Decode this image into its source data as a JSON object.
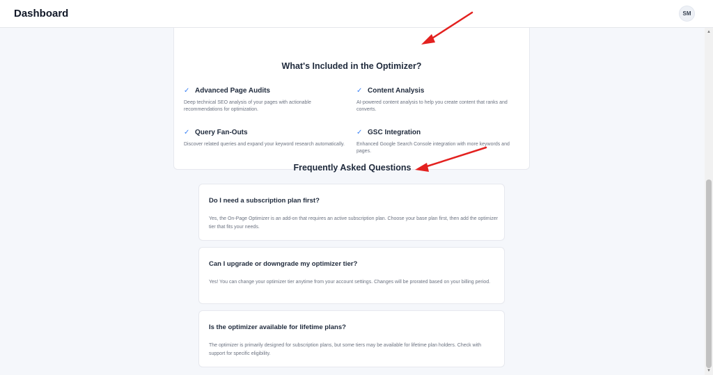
{
  "header": {
    "title": "Dashboard",
    "avatar_initials": "SM"
  },
  "included": {
    "title": "What's Included in the Optimizer?",
    "features": [
      {
        "name": "Advanced Page Audits",
        "description": "Deep technical SEO analysis of your pages with actionable recommendations for optimization."
      },
      {
        "name": "Content Analysis",
        "description": "AI-powered content analysis to help you create content that ranks and converts."
      },
      {
        "name": "Query Fan-Outs",
        "description": "Discover related queries and expand your keyword research automatically."
      },
      {
        "name": "GSC Integration",
        "description": "Enhanced Google Search Console integration with more keywords and pages."
      }
    ]
  },
  "faq": {
    "title": "Frequently Asked Questions",
    "items": [
      {
        "question": "Do I need a subscription plan first?",
        "answer": "Yes, the On-Page Optimizer is an add-on that requires an active subscription plan. Choose your base plan first, then add the optimizer tier that fits your needs."
      },
      {
        "question": "Can I upgrade or downgrade my optimizer tier?",
        "answer": "Yes! You can change your optimizer tier anytime from your account settings. Changes will be prorated based on your billing period."
      },
      {
        "question": "Is the optimizer available for lifetime plans?",
        "answer": "The optimizer is primarily designed for subscription plans, but some tiers may be available for lifetime plan holders. Check with support for specific eligibility."
      }
    ]
  },
  "colors": {
    "check": "#3b82f6",
    "annotation_arrow": "#e3211f"
  },
  "icons": {
    "check": "check-icon",
    "annotation": "red-arrow-annotation"
  }
}
